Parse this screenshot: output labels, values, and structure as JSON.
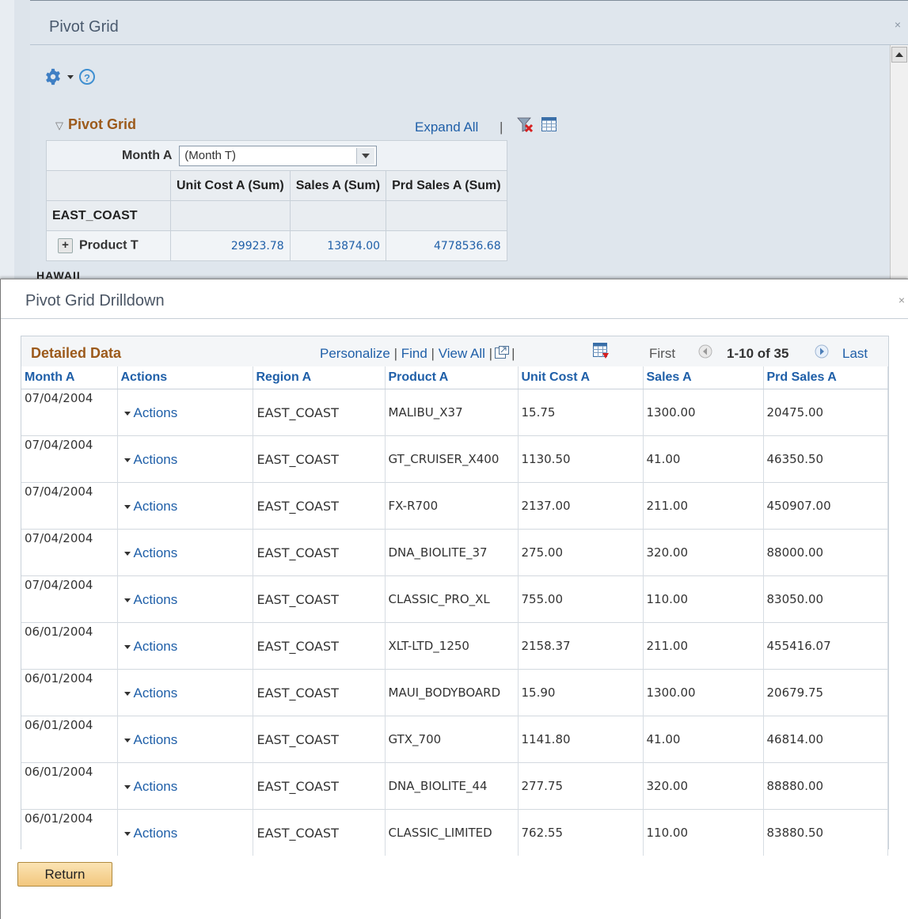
{
  "background_window": {
    "title": "Pivot Grid",
    "pivot_title": "Pivot Grid",
    "expand_all": "Expand All",
    "separator": "|",
    "month_label": "Month A",
    "month_value": "(Month T)",
    "columns": [
      "Unit Cost A (Sum)",
      "Sales A (Sum)",
      "Prd Sales A (Sum)"
    ],
    "region": "EAST_COAST",
    "product": "Product T",
    "values": [
      "29923.78",
      "13874.00",
      "4778536.68"
    ],
    "cut_off_text": "HAWAII",
    "help_glyph": "?",
    "close_glyph": "×"
  },
  "drilldown": {
    "title": "Pivot Grid Drilldown",
    "close_glyph": "×",
    "section_title": "Detailed Data",
    "links": {
      "personalize": "Personalize",
      "find": "Find",
      "view_all": "View All",
      "sep": "|"
    },
    "nav": {
      "first": "First",
      "range": "1-10 of 35",
      "last": "Last"
    },
    "columns": [
      "Month A",
      "Actions",
      "Region A",
      "Product A",
      "Unit Cost A",
      "Sales A",
      "Prd Sales A"
    ],
    "rows": [
      [
        "07/04/2004",
        "Actions",
        "EAST_COAST",
        "MALIBU_X37",
        "15.75",
        "1300.00",
        "20475.00"
      ],
      [
        "07/04/2004",
        "Actions",
        "EAST_COAST",
        "GT_CRUISER_X400",
        "1130.50",
        "41.00",
        "46350.50"
      ],
      [
        "07/04/2004",
        "Actions",
        "EAST_COAST",
        "FX-R700",
        "2137.00",
        "211.00",
        "450907.00"
      ],
      [
        "07/04/2004",
        "Actions",
        "EAST_COAST",
        "DNA_BIOLITE_37",
        "275.00",
        "320.00",
        "88000.00"
      ],
      [
        "07/04/2004",
        "Actions",
        "EAST_COAST",
        "CLASSIC_PRO_XL",
        "755.00",
        "110.00",
        "83050.00"
      ],
      [
        "06/01/2004",
        "Actions",
        "EAST_COAST",
        "XLT-LTD_1250",
        "2158.37",
        "211.00",
        "455416.07"
      ],
      [
        "06/01/2004",
        "Actions",
        "EAST_COAST",
        "MAUI_BODYBOARD",
        "15.90",
        "1300.00",
        "20679.75"
      ],
      [
        "06/01/2004",
        "Actions",
        "EAST_COAST",
        "GTX_700",
        "1141.80",
        "41.00",
        "46814.00"
      ],
      [
        "06/01/2004",
        "Actions",
        "EAST_COAST",
        "DNA_BIOLITE_44",
        "277.75",
        "320.00",
        "88880.00"
      ],
      [
        "06/01/2004",
        "Actions",
        "EAST_COAST",
        "CLASSIC_LIMITED",
        "762.55",
        "110.00",
        "83880.50"
      ]
    ],
    "return_label": "Return"
  },
  "colors": {
    "link": "#1f5fa8",
    "section_title": "#9c5a1b",
    "button_top": "#fbe4b4",
    "button_bottom": "#f2c77d"
  },
  "icons": [
    "gear-icon",
    "chevron-down-icon",
    "help-icon",
    "filter-clear-icon",
    "grid-icon",
    "zoom-icon",
    "download-icon",
    "previous-icon",
    "next-icon",
    "plus-icon",
    "close-icon"
  ]
}
